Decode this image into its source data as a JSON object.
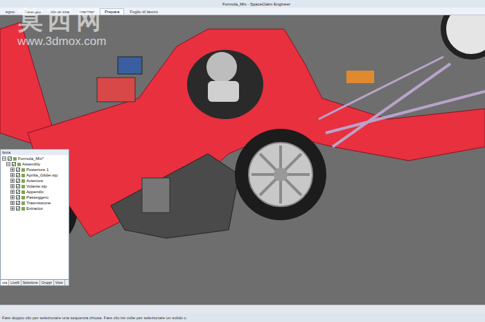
{
  "window": {
    "title": "Formula_Mix - SpaceClaim Engineer"
  },
  "ribbon": {
    "tabs": [
      {
        "label": "egno",
        "selected": false
      },
      {
        "label": "Dettaglio",
        "selected": false
      },
      {
        "label": "Visualizza",
        "selected": false
      },
      {
        "label": "Inserisci",
        "selected": false
      },
      {
        "label": "Prepara",
        "selected": true
      },
      {
        "label": "Foglio di lavoro",
        "selected": false
      }
    ]
  },
  "watermark": {
    "logo": "莫西网",
    "url": "www.3dmox.com"
  },
  "structure_panel": {
    "title": "ttura",
    "tree": [
      {
        "label": "Formula_Mix*",
        "level": 0,
        "expanded": true,
        "checked": true
      },
      {
        "label": "Assembly",
        "level": 1,
        "expanded": true,
        "checked": true
      },
      {
        "label": "Posteriore 1",
        "level": 2,
        "expanded": false,
        "checked": true
      },
      {
        "label": "Aprilia_Glider.stp",
        "level": 2,
        "expanded": false,
        "checked": true
      },
      {
        "label": "Anteriore",
        "level": 2,
        "expanded": false,
        "checked": true
      },
      {
        "label": "Volante.stp",
        "level": 2,
        "expanded": false,
        "checked": true
      },
      {
        "label": "Appendix",
        "level": 2,
        "expanded": false,
        "checked": true
      },
      {
        "label": "Passeggero",
        "level": 2,
        "expanded": false,
        "checked": true
      },
      {
        "label": "Trasmissione",
        "level": 2,
        "expanded": false,
        "checked": true
      },
      {
        "label": "Extractor",
        "level": 2,
        "expanded": false,
        "checked": true
      }
    ],
    "tabs": [
      {
        "label": "ura",
        "selected": true
      },
      {
        "label": "Livelli",
        "selected": false
      },
      {
        "label": "Selezione",
        "selected": false
      },
      {
        "label": "Gruppi",
        "selected": false
      },
      {
        "label": "Viste",
        "selected": false
      }
    ]
  },
  "status_bar": {
    "text": "Fare doppio clic per selezionare una sequenza chiusa. Fare clic tre volte per selezionare un solido c."
  }
}
